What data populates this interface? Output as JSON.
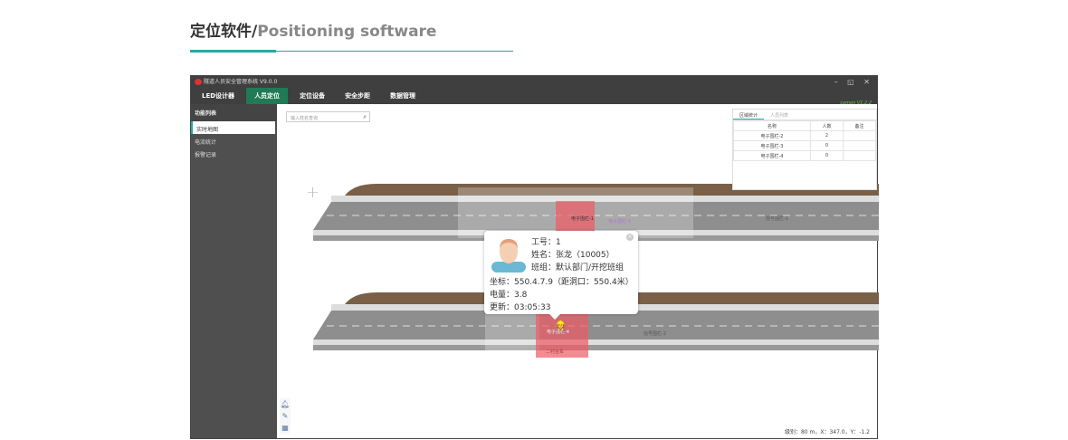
{
  "heading": {
    "cn": "定位软件/",
    "en": "Positioning software"
  },
  "window": {
    "title": "隧道人员安全管理系统 V9.0.0",
    "version": "comon V1.2.2",
    "controls": "– ◱ ✕"
  },
  "nav": [
    "LED设计器",
    "人员定位",
    "定位设备",
    "安全步距",
    "数据管理"
  ],
  "sidebar": {
    "title": "功能列表",
    "items": [
      "实时地图",
      "电流统计",
      "报警记录"
    ]
  },
  "search": {
    "placeholder": "输入姓名查询",
    "icon": "search-icon"
  },
  "panel": {
    "tabs": [
      "区域统计",
      "人员列表"
    ],
    "headers": [
      "名称",
      "人数",
      "备注"
    ],
    "rows": [
      [
        "电子围栏-2",
        "2",
        ""
      ],
      [
        "电子围栏-3",
        "0",
        ""
      ],
      [
        "电子围栏-4",
        "0",
        ""
      ]
    ]
  },
  "map": {
    "labels1": [
      "电子围栏-1",
      "电子围栏-3",
      "信号围栏-1"
    ],
    "labels2": [
      "电子围栏-4",
      "信号围栏-2",
      "二衬台车"
    ]
  },
  "tooltip": {
    "id": "工号：1",
    "name": "姓名：张龙（10005）",
    "team": "班组：默认部门/开挖班组",
    "coord": "坐标：550.4.7.9（距洞口：550.4米）",
    "battery": "电量：3.8",
    "updated": "更新：03:05:33"
  },
  "status": "级别：80 m，X：347.0，Y：-1.2"
}
